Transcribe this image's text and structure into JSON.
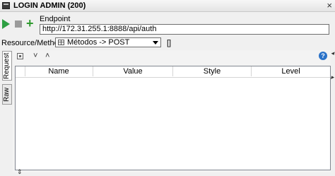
{
  "window": {
    "title": "LOGIN ADMIN (200)"
  },
  "toolbar": {
    "run": "play-icon",
    "stop": "stop-icon",
    "add": "+"
  },
  "endpoint": {
    "label": "Endpoint",
    "value": "http://172.31.255.1:8888/api/auth"
  },
  "resource_method": {
    "label": "Resource/Method:",
    "selected": "Métodos -> POST",
    "extra": "[]"
  },
  "tabs": [
    {
      "label": "Request"
    },
    {
      "label": "Raw"
    }
  ],
  "params_table": {
    "columns": [
      "Name",
      "Value",
      "Style",
      "Level"
    ],
    "rows": []
  },
  "icons": {
    "help": "?",
    "collapse": "˅",
    "expand": "˄"
  }
}
